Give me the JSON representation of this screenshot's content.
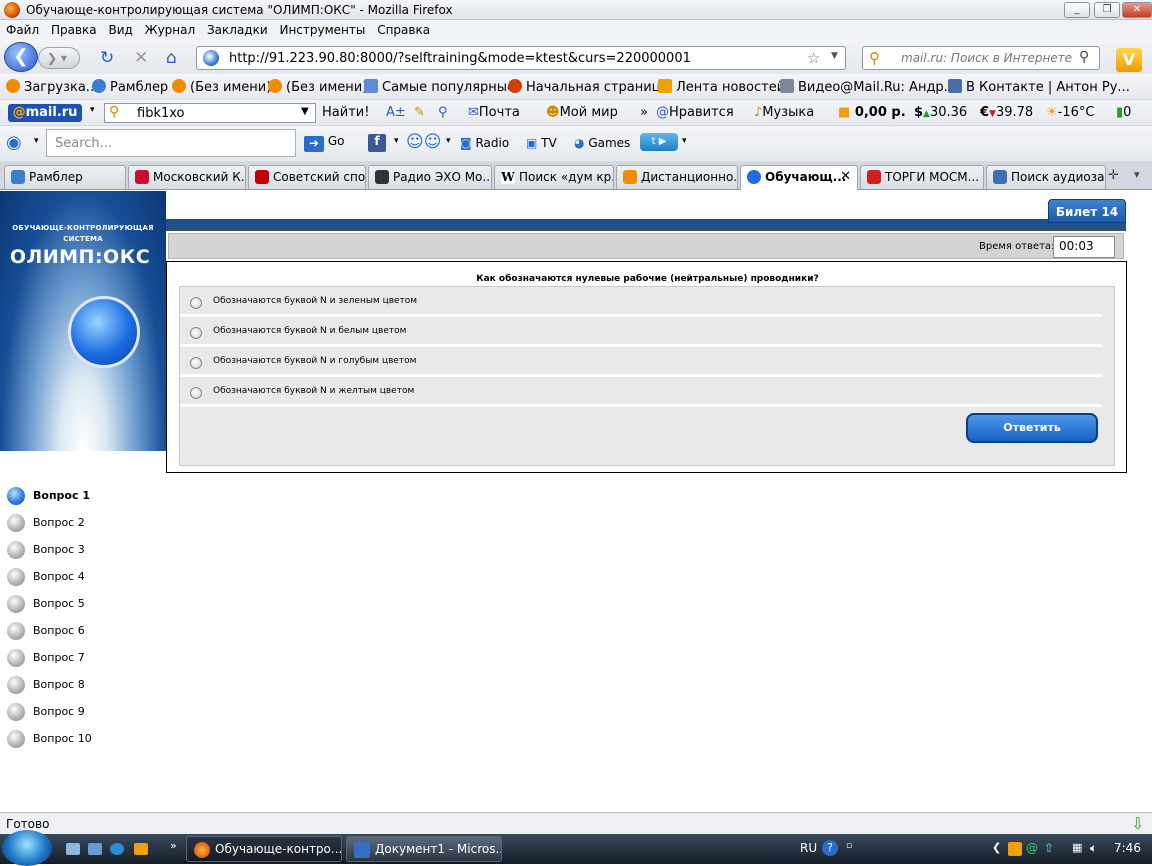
{
  "window": {
    "title": "Обучающе-контролирующая система \"ОЛИМП:ОКС\" - Mozilla Firefox"
  },
  "menu": [
    "Файл",
    "Правка",
    "Вид",
    "Журнал",
    "Закладки",
    "Инструменты",
    "Справка"
  ],
  "nav": {
    "url": "http://91.223.90.80:8000/?selftraining&mode=ktest&curs=220000001",
    "search_placeholder": "mail.ru: Поиск в Интернете"
  },
  "bookmarks": [
    "Загрузка...",
    "Рамблер",
    "(Без имени)",
    "(Без имени)",
    "Самые популярные",
    "Начальная страница",
    "Лента новостей",
    "Видео@Mail.Ru: Андр...",
    "В Контакте | Антон Ру..."
  ],
  "mailbar": {
    "logo": "mail.ru",
    "query": "fibk1xo",
    "find": "Найти!",
    "mail": "Почта",
    "myworld": "Мой мир",
    "likes": "Нравится",
    "music": "Музыка",
    "money": "0,00 р.",
    "usd": "30.36",
    "eur": "39.78",
    "weather": "-16°C",
    "traffic": "0"
  },
  "toolbar3": {
    "placeholder": "Search...",
    "go": "Go",
    "radio": "Radio",
    "tv": "TV",
    "games": "Games"
  },
  "tabs": [
    {
      "label": "Рамблер",
      "color": "#3a7ed2"
    },
    {
      "label": "Московский К...",
      "color": "#c8102e"
    },
    {
      "label": "Советский спо...",
      "color": "#c40000"
    },
    {
      "label": "Радио ЭХО Мо...",
      "color": "#333333"
    },
    {
      "label": "Поиск «дум кр...",
      "color": "#ffffff"
    },
    {
      "label": "Дистанционно...",
      "color": "#f08c00"
    },
    {
      "label": "Обучающ...",
      "color": "#1b6de0"
    },
    {
      "label": "ТОРГИ МОСМ...",
      "color": "#d02020"
    },
    {
      "label": "Поиск аудиоза...",
      "color": "#3a6fb5"
    }
  ],
  "banner": {
    "line1": "ОБУЧАЮЩЕ-КОНТРОЛИРУЮЩАЯ",
    "line2": "СИСТЕМА",
    "brand": "ОЛИМП:ОКС"
  },
  "ticket": "Билет 14",
  "timer": {
    "label": "Время ответа:",
    "value": "00:03"
  },
  "question": {
    "text": "Как обозначаются нулевые рабочие (нейтральные) проводники?",
    "answers": [
      "Обозначаются буквой N и зеленым цветом",
      "Обозначаются буквой N и белым цветом",
      "Обозначаются буквой N и голубым цветом",
      "Обозначаются буквой N и желтым цветом"
    ],
    "submit": "Ответить"
  },
  "questions": [
    "Вопрос 1",
    "Вопрос 2",
    "Вопрос 3",
    "Вопрос 4",
    "Вопрос 5",
    "Вопрос 6",
    "Вопрос 7",
    "Вопрос 8",
    "Вопрос 9",
    "Вопрос 10"
  ],
  "current_question": 1,
  "status": "Готово",
  "taskbar": {
    "tasks": [
      "Обучающе-контро...",
      "Документ1 - Micros..."
    ],
    "lang": "RU",
    "clock": "7:46"
  }
}
